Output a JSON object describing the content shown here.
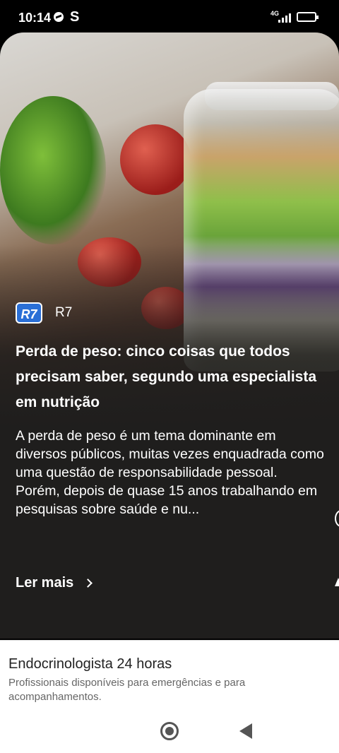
{
  "status_bar": {
    "time": "10:14",
    "carrier_icon": "S",
    "network": "4G",
    "battery": "89"
  },
  "card": {
    "source": {
      "logo_text": "R7",
      "name": "R7"
    },
    "headline": "Perda de peso: cinco coisas que todos precisam saber, segundo uma especialista em nutrição",
    "summary": "A perda de peso é um tema dominante em diversos públicos, muitas vezes enquadrada como uma questão de responsabilidade pessoal.\nPorém, depois de quase 15 anos trabalhando em pesquisas sobre saúde e nu...",
    "read_more": "Ler mais"
  },
  "ad": {
    "title": "Endocrinologista 24 horas",
    "description": "Profissionais disponíveis para emergências e para acompanhamentos."
  },
  "icons": {
    "message": "messenger-icon",
    "home": "home-icon",
    "back": "back-icon"
  }
}
